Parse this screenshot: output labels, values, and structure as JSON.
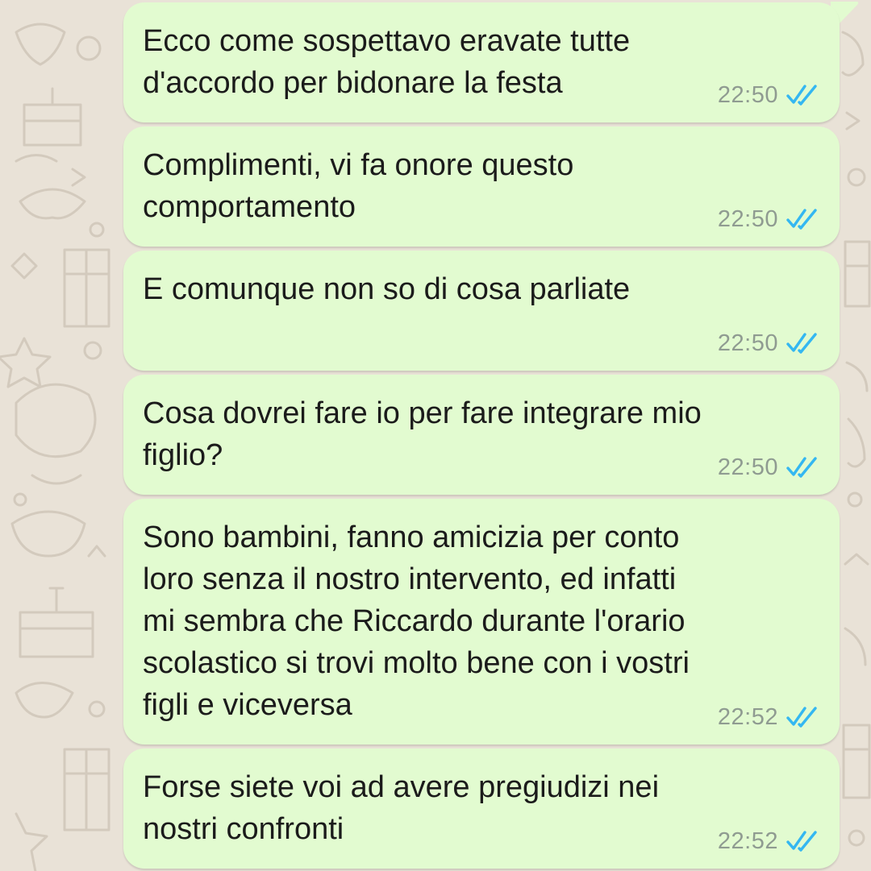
{
  "chat": {
    "background_color": "#e9e2d7",
    "bubble_color": "#e2fbd0",
    "read_tick_color": "#34b7f1",
    "messages": [
      {
        "text": "Ecco come sospettavo eravate tutte\nd'accordo per bidonare la festa",
        "time": "22:50",
        "status_icon": "double-check-read-icon"
      },
      {
        "text": "Complimenti, vi fa onore questo\ncomportamento",
        "time": "22:50",
        "status_icon": "double-check-read-icon"
      },
      {
        "text": "E comunque non so di cosa parliate",
        "time": "22:50",
        "status_icon": "double-check-read-icon"
      },
      {
        "text": "Cosa dovrei fare io per fare integrare mio\nfiglio?",
        "time": "22:50",
        "status_icon": "double-check-read-icon"
      },
      {
        "text": "Sono bambini, fanno amicizia per conto\nloro senza il nostro intervento, ed infatti\nmi sembra che Riccardo durante l'orario\nscolastico si trovi molto bene con i vostri\nfigli e viceversa",
        "time": "22:52",
        "status_icon": "double-check-read-icon"
      },
      {
        "text": "Forse siete voi ad avere pregiudizi nei\nnostri confronti",
        "time": "22:52",
        "status_icon": "double-check-read-icon"
      }
    ]
  }
}
